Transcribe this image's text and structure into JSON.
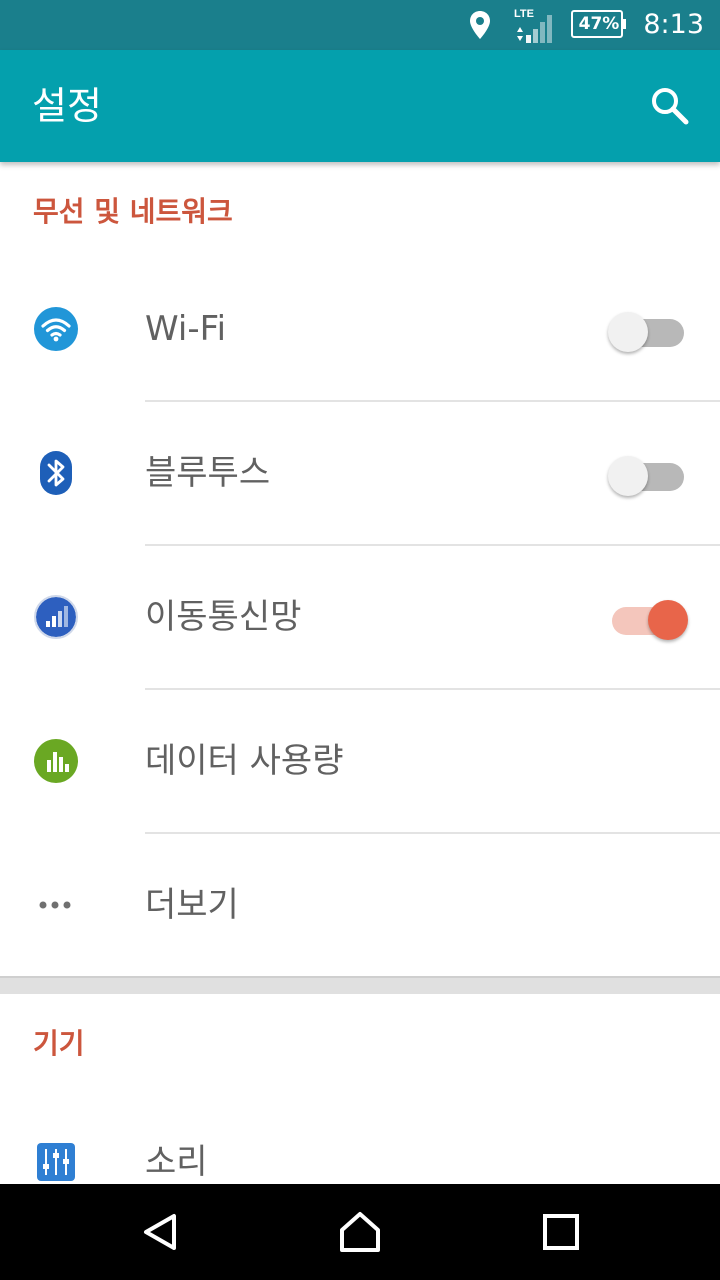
{
  "status_bar": {
    "time": "8:13",
    "battery_percent": "47%",
    "network_type": "LTE",
    "icons": [
      "location-icon",
      "lte-signal-icon",
      "battery-icon"
    ]
  },
  "app_bar": {
    "title": "설정",
    "search_icon": "search-icon"
  },
  "sections": [
    {
      "header": "무선 및 네트워크",
      "items": [
        {
          "label": "Wi-Fi",
          "icon": "wifi-icon",
          "toggle": "off"
        },
        {
          "label": "블루투스",
          "icon": "bluetooth-icon",
          "toggle": "off"
        },
        {
          "label": "이동통신망",
          "icon": "mobile-network-icon",
          "toggle": "on"
        },
        {
          "label": "데이터 사용량",
          "icon": "data-usage-icon"
        },
        {
          "label": "더보기",
          "icon": "more-dots-icon"
        }
      ]
    },
    {
      "header": "기기",
      "items": [
        {
          "label": "소리",
          "icon": "sound-equalizer-icon"
        }
      ]
    }
  ],
  "nav_bar": {
    "buttons": [
      "back-icon",
      "home-icon",
      "recents-icon"
    ]
  },
  "colors": {
    "status_bar": "#1a7f8c",
    "app_bar": "#04a0ad",
    "section_header": "#cc563d",
    "toggle_on": "#e8654a",
    "toggle_off": "#b8b8b8"
  }
}
